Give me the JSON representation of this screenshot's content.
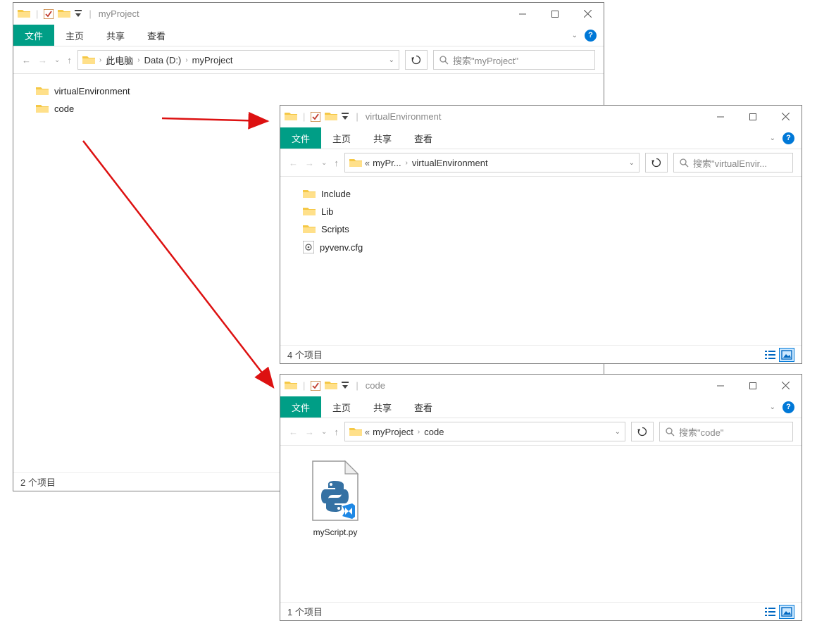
{
  "ribbon": {
    "file": "文件",
    "home": "主页",
    "share": "共享",
    "view": "查看"
  },
  "help": "?",
  "windows": [
    {
      "title": "myProject",
      "breadcrumb": [
        "此电脑",
        "Data (D:)",
        "myProject"
      ],
      "search_placeholder": "搜索\"myProject\"",
      "status": "2 个项目",
      "items": [
        {
          "name": "virtualEnvironment",
          "type": "folder"
        },
        {
          "name": "code",
          "type": "folder"
        }
      ]
    },
    {
      "title": "virtualEnvironment",
      "breadcrumb_prefix": "«",
      "breadcrumb": [
        "myPr...",
        "virtualEnvironment"
      ],
      "search_placeholder": "搜索\"virtualEnvir...",
      "status": "4 个项目",
      "items": [
        {
          "name": "Include",
          "type": "folder"
        },
        {
          "name": "Lib",
          "type": "folder"
        },
        {
          "name": "Scripts",
          "type": "folder"
        },
        {
          "name": "pyvenv.cfg",
          "type": "cfg"
        }
      ]
    },
    {
      "title": "code",
      "breadcrumb_prefix": "«",
      "breadcrumb": [
        "myProject",
        "code"
      ],
      "search_placeholder": "搜索\"code\"",
      "status": "1 个项目",
      "items": [
        {
          "name": "myScript.py",
          "type": "python"
        }
      ]
    }
  ]
}
